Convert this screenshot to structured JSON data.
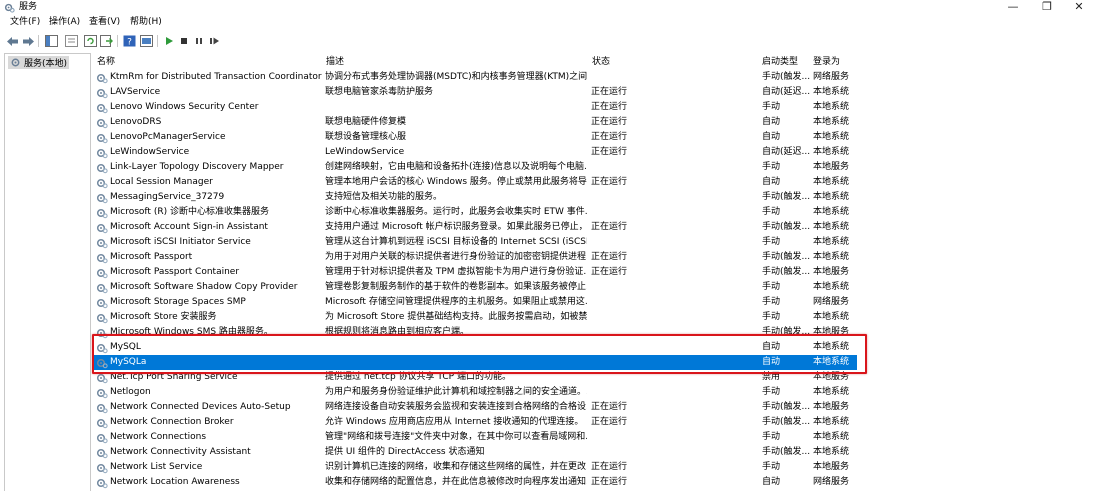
{
  "window": {
    "title": "服务",
    "min_glyph": "—",
    "max_glyph": "❐",
    "close_glyph": "✕"
  },
  "menu": {
    "file": "文件(F)",
    "action": "操作(A)",
    "view": "查看(V)",
    "help": "帮助(H)"
  },
  "toolbar": {
    "icons": [
      "back-arrow-icon",
      "forward-arrow-icon",
      "console-tree-icon",
      "properties-icon",
      "refresh-icon",
      "export-icon",
      "help-icon",
      "details-icon",
      "play-icon",
      "stop-icon",
      "pause-icon",
      "restart-icon"
    ]
  },
  "tree": {
    "root_label": "服务(本地)"
  },
  "columns": {
    "name": "名称",
    "description": "描述",
    "status": "状态",
    "startup": "启动类型",
    "logon": "登录为"
  },
  "rows": [
    {
      "name": "KtmRm for Distributed Transaction Coordinator",
      "desc": "协调分布式事务处理协调器(MSDTC)和内核事务管理器(KTM)之间...",
      "status": "",
      "startup": "手动(触发...",
      "logon": "网络服务"
    },
    {
      "name": "LAVService",
      "desc": "联想电脑管家杀毒防护服务",
      "status": "正在运行",
      "startup": "自动(延迟...",
      "logon": "本地系统"
    },
    {
      "name": "Lenovo Windows Security Center",
      "desc": "",
      "status": "正在运行",
      "startup": "手动",
      "logon": "本地系统"
    },
    {
      "name": "LenovoDRS",
      "desc": "联想电脑硬件修复模",
      "status": "正在运行",
      "startup": "自动",
      "logon": "本地系统"
    },
    {
      "name": "LenovoPcManagerService",
      "desc": "联想设备管理核心服",
      "status": "正在运行",
      "startup": "自动",
      "logon": "本地系统"
    },
    {
      "name": "LeWindowService",
      "desc": "LeWindowService",
      "status": "正在运行",
      "startup": "自动(延迟...",
      "logon": "本地系统"
    },
    {
      "name": "Link-Layer Topology Discovery Mapper",
      "desc": "创建网络映射，它由电脑和设备拓扑(连接)信息以及说明每个电脑...",
      "status": "",
      "startup": "手动",
      "logon": "本地服务"
    },
    {
      "name": "Local Session Manager",
      "desc": "管理本地用户会话的核心 Windows 服务。停止或禁用此服务将导...",
      "status": "正在运行",
      "startup": "自动",
      "logon": "本地系统"
    },
    {
      "name": "MessagingService_37279",
      "desc": "支持短信及相关功能的服务。",
      "status": "",
      "startup": "手动(触发...",
      "logon": "本地系统"
    },
    {
      "name": "Microsoft (R) 诊断中心标准收集器服务",
      "desc": "诊断中心标准收集器服务。运行时，此服务会收集实时 ETW 事件...",
      "status": "",
      "startup": "手动",
      "logon": "本地系统"
    },
    {
      "name": "Microsoft Account Sign-in Assistant",
      "desc": "支持用户通过 Microsoft 帐户标识服务登录。如果此服务已停止，...",
      "status": "正在运行",
      "startup": "手动(触发...",
      "logon": "本地系统"
    },
    {
      "name": "Microsoft iSCSI Initiator Service",
      "desc": "管理从这台计算机到远程 iSCSI 目标设备的 Internet SCSI (iSCSI)会...",
      "status": "",
      "startup": "手动",
      "logon": "本地系统"
    },
    {
      "name": "Microsoft Passport",
      "desc": "为用于对用户关联的标识提供者进行身份验证的加密密钥提供进程...",
      "status": "正在运行",
      "startup": "手动(触发...",
      "logon": "本地系统"
    },
    {
      "name": "Microsoft Passport Container",
      "desc": "管理用于针对标识提供者及 TPM 虚拟智能卡为用户进行身份验证...",
      "status": "正在运行",
      "startup": "手动(触发...",
      "logon": "本地服务"
    },
    {
      "name": "Microsoft Software Shadow Copy Provider",
      "desc": "管理卷影复制服务制作的基于软件的卷影副本。如果该服务被停止...",
      "status": "",
      "startup": "手动",
      "logon": "本地系统"
    },
    {
      "name": "Microsoft Storage Spaces SMP",
      "desc": "Microsoft 存储空间管理提供程序的主机服务。如果阻止或禁用这...",
      "status": "",
      "startup": "手动",
      "logon": "网络服务"
    },
    {
      "name": "Microsoft Store 安装服务",
      "desc": "为 Microsoft Store 提供基础结构支持。此服务按需启动，如被禁...",
      "status": "",
      "startup": "手动",
      "logon": "本地系统"
    },
    {
      "name": "Microsoft Windows SMS 路由器服务。",
      "desc": "根据规则将消息路由到相应客户端。",
      "status": "",
      "startup": "手动(触发...",
      "logon": "本地服务"
    },
    {
      "name": "MySQL",
      "desc": "",
      "status": "",
      "startup": "自动",
      "logon": "本地系统"
    },
    {
      "name": "MySQLa",
      "desc": "",
      "status": "",
      "startup": "自动",
      "logon": "本地系统"
    },
    {
      "name": "Net.Tcp Port Sharing Service",
      "desc": "提供通过 net.tcp 协议共享 TCP 端口的功能。",
      "status": "",
      "startup": "禁用",
      "logon": "本地服务"
    },
    {
      "name": "Netlogon",
      "desc": "为用户和服务身份验证维护此计算机和域控制器之间的安全通道。...",
      "status": "",
      "startup": "手动",
      "logon": "本地系统"
    },
    {
      "name": "Network Connected Devices Auto-Setup",
      "desc": "网络连接设备自动安装服务会监视和安装连接到合格网络的合格设...",
      "status": "正在运行",
      "startup": "手动(触发...",
      "logon": "本地服务"
    },
    {
      "name": "Network Connection Broker",
      "desc": "允许 Windows 应用商店应用从 Internet 接收通知的代理连接。",
      "status": "正在运行",
      "startup": "手动(触发...",
      "logon": "本地系统"
    },
    {
      "name": "Network Connections",
      "desc": "管理\"网络和拨号连接\"文件夹中对象，在其中你可以查看局域网和...",
      "status": "",
      "startup": "手动",
      "logon": "本地系统"
    },
    {
      "name": "Network Connectivity Assistant",
      "desc": "提供 UI 组件的 DirectAccess 状态通知",
      "status": "",
      "startup": "手动(触发...",
      "logon": "本地系统"
    },
    {
      "name": "Network List Service",
      "desc": "识别计算机已连接的网络，收集和存储这些网络的属性，并在更改...",
      "status": "正在运行",
      "startup": "手动",
      "logon": "本地服务"
    },
    {
      "name": "Network Location Awareness",
      "desc": "收集和存储网络的配置信息，并在此信息被修改时向程序发出通知...",
      "status": "正在运行",
      "startup": "自动",
      "logon": "网络服务"
    }
  ],
  "selected_row": "MySQLa"
}
